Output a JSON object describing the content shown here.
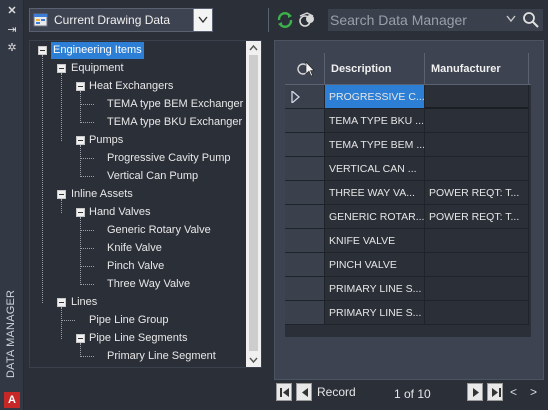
{
  "palette": {
    "title": "DATA MANAGER",
    "close_glyph": "✕",
    "pin_glyph": "⇥",
    "settings_glyph": "✲",
    "app_logo": "A"
  },
  "toolbar": {
    "drawing_dropdown_value": "Current Drawing Data",
    "search_placeholder": "Search Data Manager"
  },
  "tree": {
    "nodes": [
      {
        "label": "Engineering Items"
      },
      {
        "label": "Equipment"
      },
      {
        "label": "Heat Exchangers"
      },
      {
        "label": "TEMA type BEM Exchanger"
      },
      {
        "label": "TEMA type BKU Exchanger"
      },
      {
        "label": "Pumps"
      },
      {
        "label": "Progressive Cavity Pump"
      },
      {
        "label": "Vertical Can Pump"
      },
      {
        "label": "Inline Assets"
      },
      {
        "label": "Hand Valves"
      },
      {
        "label": "Generic Rotary Valve"
      },
      {
        "label": "Knife Valve"
      },
      {
        "label": "Pinch Valve"
      },
      {
        "label": "Three Way Valve"
      },
      {
        "label": "Lines"
      },
      {
        "label": "Pipe Line Group"
      },
      {
        "label": "Pipe Line Segments"
      },
      {
        "label": "Primary Line Segment"
      }
    ]
  },
  "grid": {
    "columns": [
      "Description",
      "Manufacturer"
    ],
    "rows": [
      {
        "description": "PROGRESSIVE C...",
        "manufacturer": ""
      },
      {
        "description": "TEMA TYPE BKU ...",
        "manufacturer": ""
      },
      {
        "description": "TEMA TYPE BEM ...",
        "manufacturer": ""
      },
      {
        "description": "VERTICAL CAN ...",
        "manufacturer": ""
      },
      {
        "description": "THREE WAY VA...",
        "manufacturer": "POWER REQT: T..."
      },
      {
        "description": "GENERIC ROTAR...",
        "manufacturer": "POWER REQT: T..."
      },
      {
        "description": "KNIFE VALVE",
        "manufacturer": ""
      },
      {
        "description": "PINCH VALVE",
        "manufacturer": ""
      },
      {
        "description": "PRIMARY LINE S...",
        "manufacturer": ""
      },
      {
        "description": "PRIMARY LINE S...",
        "manufacturer": ""
      }
    ]
  },
  "nav": {
    "record_label": "Record",
    "record_position": "1 of 10"
  },
  "colors": {
    "selection": "#2d7fd6",
    "panel": "#3d4350",
    "background": "#2b2f38",
    "refresh_green": "#3cb24a"
  }
}
